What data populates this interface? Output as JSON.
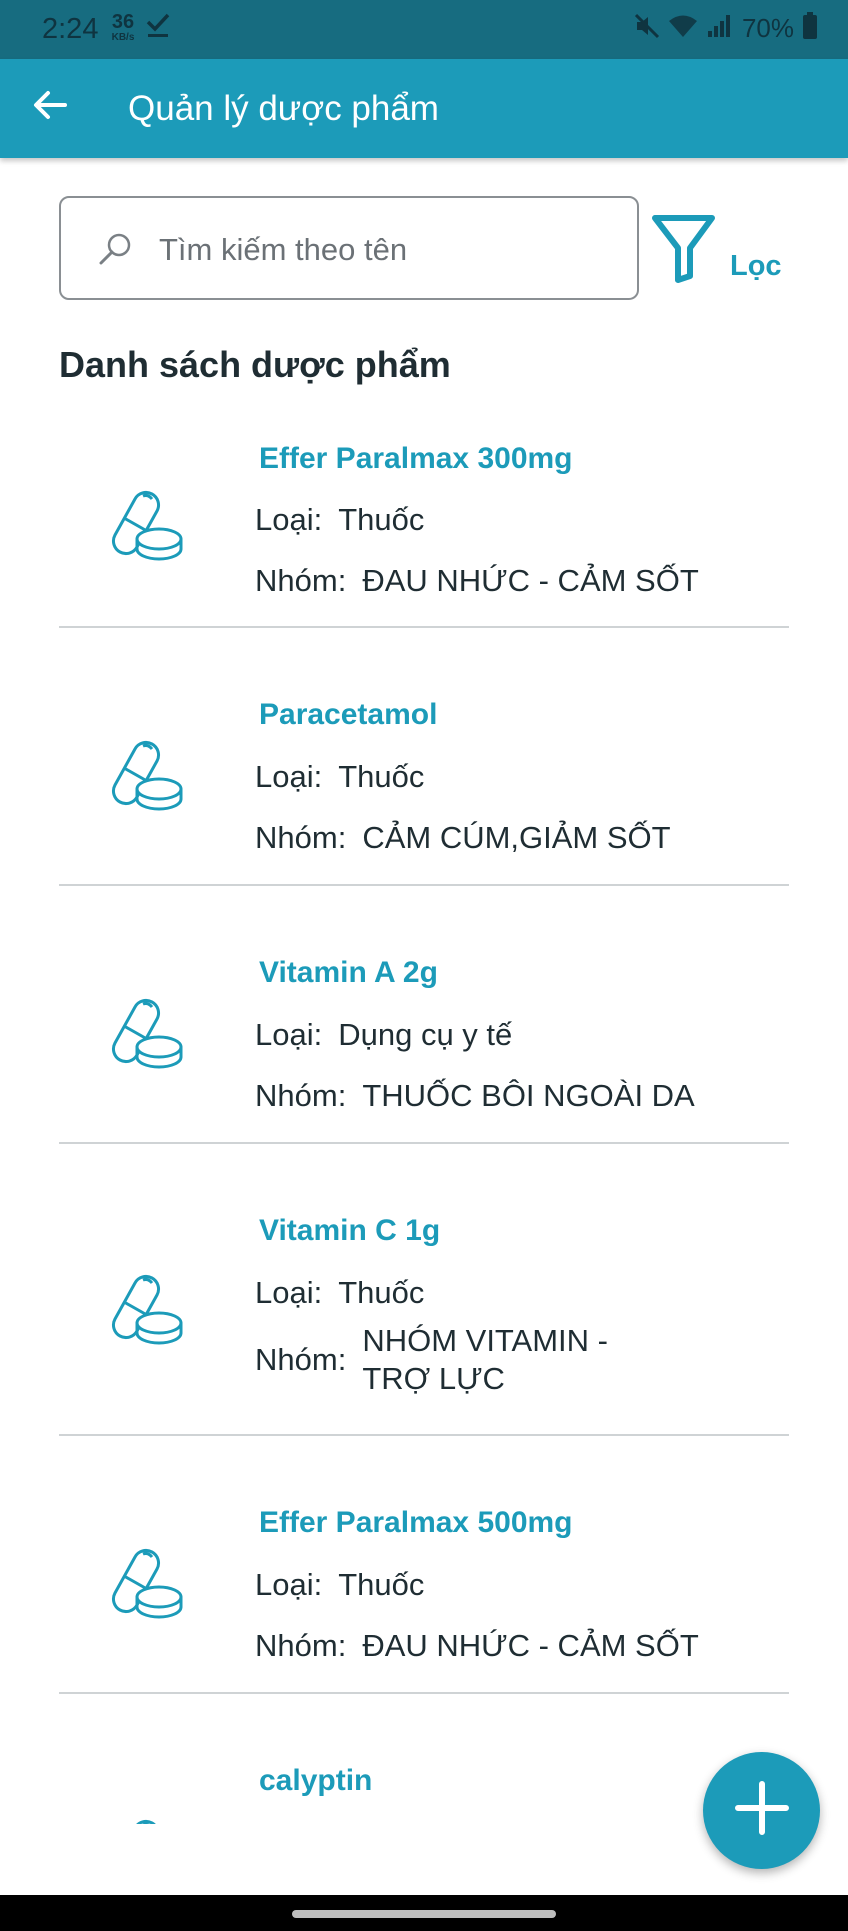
{
  "status_bar": {
    "time": "2:24",
    "net_speed_value": "36",
    "net_speed_unit": "KB/s",
    "battery": "70%"
  },
  "app_bar": {
    "title": "Quản lý dược phẩm",
    "back_icon": "arrow-left-icon"
  },
  "search": {
    "placeholder": "Tìm kiếm theo tên",
    "value": "",
    "icon": "search-icon"
  },
  "filter": {
    "label": "Lọc",
    "icon": "funnel-icon"
  },
  "list": {
    "title": "Danh sách dược phẩm",
    "type_label": "Loại:",
    "group_label": "Nhóm:",
    "item_icon": "pills-icon",
    "items": [
      {
        "name": "Effer Paralmax 300mg",
        "type": "Thuốc",
        "group": "ĐAU NHỨC - CẢM SỐT"
      },
      {
        "name": "Paracetamol",
        "type": "Thuốc",
        "group": "CẢM CÚM,GIẢM SỐT"
      },
      {
        "name": "Vitamin A 2g",
        "type": "Dụng cụ y tế",
        "group": "THUỐC BÔI NGOÀI DA"
      },
      {
        "name": "Vitamin C 1g",
        "type": "Thuốc",
        "group": "NHÓM VITAMIN - TRỢ LỰC"
      },
      {
        "name": "Effer Paralmax 500mg",
        "type": "Thuốc",
        "group": "ĐAU NHỨC - CẢM SỐT"
      },
      {
        "name": "calyptin",
        "type": "",
        "group": ""
      }
    ]
  },
  "fab": {
    "icon": "plus-icon"
  },
  "colors": {
    "primary": "#1c9bb9",
    "status_bar": "#176c80",
    "divider": "#cfd3d5"
  }
}
